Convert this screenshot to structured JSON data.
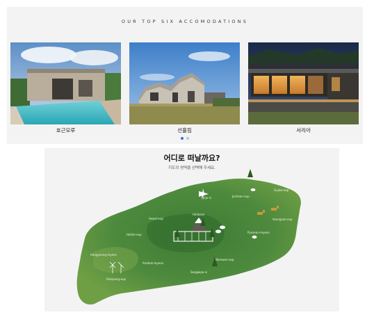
{
  "accommodations": {
    "title": "OUR TOP SIX ACCOMODATIONS",
    "items": [
      {
        "name": "호근모루",
        "photo_icon": "villa-pool-photo"
      },
      {
        "name": "선흘림",
        "photo_icon": "concrete-house-photo"
      },
      {
        "name": "서리아",
        "photo_icon": "night-glass-house-photo"
      }
    ],
    "pagination": {
      "count": 2,
      "active": 1
    }
  },
  "map": {
    "heading": "어디로 떠날까요?",
    "subheading": "지도의 영역을 선택해 주세요.",
    "areas": [
      {
        "key": "jeju-si",
        "label": "Jeju-si"
      },
      {
        "key": "jocheon",
        "label": "Jocheon-eup"
      },
      {
        "key": "gujwa",
        "label": "Gujwa-eup"
      },
      {
        "key": "aewol",
        "label": "Aewol-eup"
      },
      {
        "key": "halla",
        "label": "Hallasan"
      },
      {
        "key": "hallim",
        "label": "Hallim-eup"
      },
      {
        "key": "seongsan",
        "label": "Seongsan-eup"
      },
      {
        "key": "pyoseon",
        "label": "Pyoseon-myeon"
      },
      {
        "key": "hangyeong",
        "label": "Hangyeong-myeon"
      },
      {
        "key": "andeok",
        "label": "Andeok-myeon"
      },
      {
        "key": "namwon",
        "label": "Namwon-eup"
      },
      {
        "key": "seogwipo",
        "label": "Seogwipo-si"
      },
      {
        "key": "daejeong",
        "label": "Daejeong-eup"
      }
    ],
    "colors": {
      "island_dark": "#2e6b2a",
      "island_light": "#6f9f45",
      "sky_label": "#eef5e6"
    }
  }
}
